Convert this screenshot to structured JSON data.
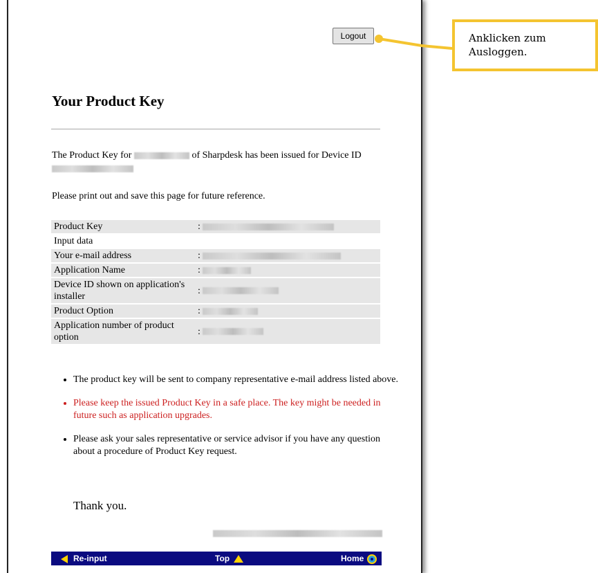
{
  "header": {
    "logout_label": "Logout"
  },
  "callout": {
    "text": "Anklicken zum Ausloggen."
  },
  "main": {
    "title": "Your Product Key",
    "intro_part1": "The Product Key for",
    "intro_part2": "of Sharpdesk has been issued for Device ID",
    "print_note": "Please print out and save this page for future reference."
  },
  "key_table": {
    "rows": [
      {
        "label": "Product Key",
        "sep": ":"
      },
      {
        "label": "Input data",
        "sep": ""
      },
      {
        "label": "Your e-mail address",
        "sep": ":"
      },
      {
        "label": "Application Name",
        "sep": ":"
      },
      {
        "label": "Device ID shown on application's installer",
        "sep": ":"
      },
      {
        "label": "Product Option",
        "sep": ":"
      },
      {
        "label": "Application number of product option",
        "sep": ":"
      }
    ]
  },
  "notes": [
    "The product key will be sent to company representative e-mail address listed above.",
    "Please keep the issued Product Key in a safe place. The key might be needed in future such as application upgrades.",
    "Please ask your sales representative or service advisor if you have any question about a procedure of Product Key request."
  ],
  "closing": {
    "thanks": "Thank you."
  },
  "navbar": {
    "reinput": "Re-input",
    "top": "Top",
    "home": "Home"
  },
  "colors": {
    "navbar": "#0b0b80",
    "accent_yellow": "#f4c430",
    "warning_red": "#cc1f1f"
  }
}
